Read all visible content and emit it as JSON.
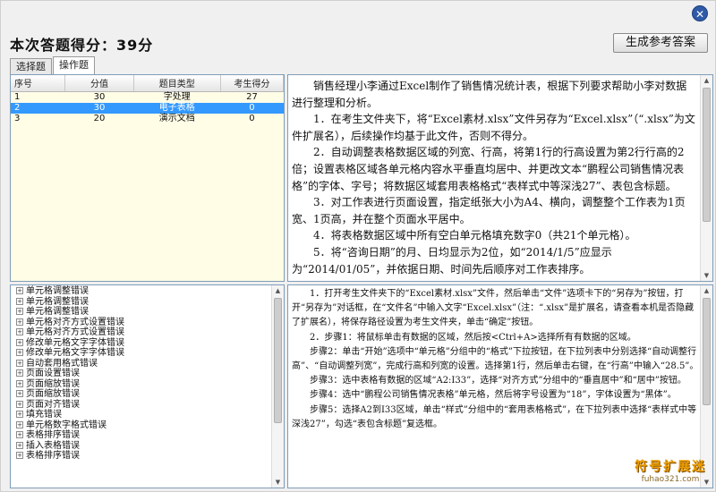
{
  "header": {
    "score_title": "本次答题得分：39分",
    "generate_button": "生成参考答案",
    "close_icon": "close-icon"
  },
  "tabs": [
    {
      "label": "选择题",
      "active": false
    },
    {
      "label": "操作题",
      "active": true
    }
  ],
  "score_table": {
    "columns": [
      "序号",
      "分值",
      "题目类型",
      "考生得分"
    ],
    "rows": [
      {
        "no": "1",
        "value": "30",
        "type": "字处理",
        "score": "27",
        "selected": false
      },
      {
        "no": "2",
        "value": "30",
        "type": "电子表格",
        "score": "0",
        "selected": true
      },
      {
        "no": "3",
        "value": "20",
        "type": "演示文档",
        "score": "0",
        "selected": false
      }
    ]
  },
  "question": {
    "paragraphs": [
      "销售经理小李通过Excel制作了销售情况统计表，根据下列要求帮助小李对数据进行整理和分析。",
      "1．在考生文件夹下，将“Excel素材.xlsx”文件另存为“Excel.xlsx”（“.xlsx”为文件扩展名），后续操作均基于此文件，否则不得分。",
      "2．自动调整表格数据区域的列宽、行高，将第1行的行高设置为第2行行高的2倍；设置表格区域各单元格内容水平垂直均居中、并更改文本“鹏程公司销售情况表格”的字体、字号；将数据区域套用表格格式“表样式中等深浅27”、表包含标题。",
      "3．对工作表进行页面设置，指定纸张大小为A4、横向，调整整个工作表为1页宽、1页高，并在整个页面水平居中。",
      "4．将表格数据区域中所有空白单元格填充数字0（共21个单元格）。",
      "5．将“咨询日期”的月、日均显示为2位，如“2014/1/5”应显示为“2014/01/05”，并依据日期、时间先后顺序对工作表排序。"
    ]
  },
  "error_tree": {
    "items": [
      "单元格调整错误",
      "单元格调整错误",
      "单元格调整错误",
      "单元格对齐方式设置错误",
      "单元格对齐方式设置错误",
      "修改单元格文字字体错误",
      "修改单元格文字字体错误",
      "自动套用格式错误",
      "页面设置错误",
      "页面缩放错误",
      "页面缩放错误",
      "页面对齐错误",
      "填充错误",
      "单元格数字格式错误",
      "表格排序错误",
      "插入表格错误",
      "表格排序错误"
    ]
  },
  "answer": {
    "paragraphs": [
      "1．打开考生文件夹下的“Excel素材.xlsx”文件，然后单击“文件”选项卡下的“另存为”按钮，打开“另存为”对话框，在“文件名”中输入文字“Excel.xlsx”（注：“.xlsx”是扩展名，请查看本机是否隐藏了扩展名），将保存路径设置为考生文件夹，单击“确定”按钮。",
      "2．步骤1：将鼠标单击有数据的区域，然后按<Ctrl+A>选择所有有数据的区域。",
      "步骤2：单击“开始”选项中“单元格”分组中的“格式”下拉按钮，在下拉列表中分别选择“自动调整行高”、“自动调整列宽”，完成行高和列宽的设置。选择第1行，然后单击右键，在“行高”中输入“28.5”。",
      "步骤3：选中表格有数据的区域“A2:I33”，选择“对齐方式”分组中的“垂直居中”和“居中”按钮。",
      "步骤4：选中“鹏程公司销售情况表格”单元格，然后将字号设置为“18”，字体设置为“黑体”。",
      "步骤5：选择A2到I33区域，单击“样式”分组中的“套用表格格式”，在下拉列表中选择“表样式中等深浅27”，勾选“表包含标题”复选框。"
    ]
  },
  "watermark": {
    "name": "符号扩展迷",
    "url": "fuhao321.com"
  }
}
